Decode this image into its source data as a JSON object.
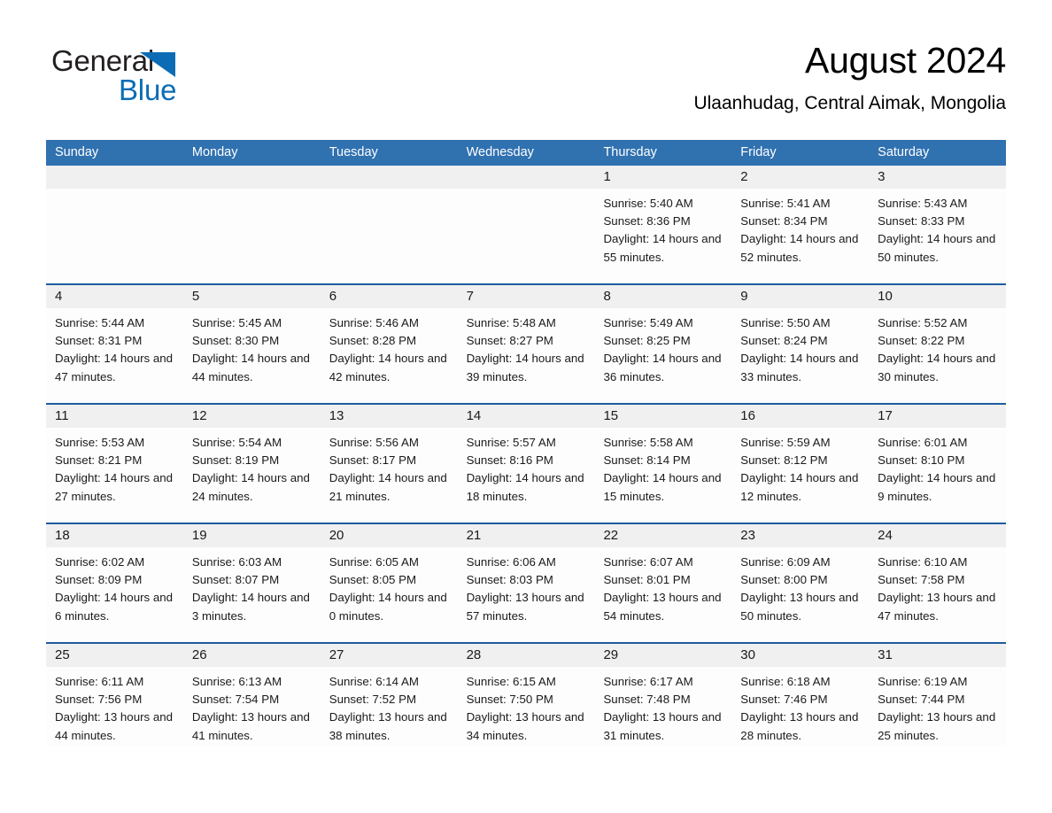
{
  "logo": {
    "word_general": "General",
    "word_blue": "Blue",
    "triangle_color": "#0b6cb5"
  },
  "header": {
    "title": "August 2024",
    "location": "Ulaanhudag, Central Aimak, Mongolia"
  },
  "theme": {
    "header_blue": "#3071b0",
    "separator_blue": "#1f5c9e",
    "daynum_band": "#f0f0f0",
    "text": "#1a1a1a"
  },
  "day_headers": [
    "Sunday",
    "Monday",
    "Tuesday",
    "Wednesday",
    "Thursday",
    "Friday",
    "Saturday"
  ],
  "weeks": [
    [
      {
        "day": "",
        "sunrise": "",
        "sunset": "",
        "daylight": ""
      },
      {
        "day": "",
        "sunrise": "",
        "sunset": "",
        "daylight": ""
      },
      {
        "day": "",
        "sunrise": "",
        "sunset": "",
        "daylight": ""
      },
      {
        "day": "",
        "sunrise": "",
        "sunset": "",
        "daylight": ""
      },
      {
        "day": "1",
        "sunrise": "Sunrise: 5:40 AM",
        "sunset": "Sunset: 8:36 PM",
        "daylight": "Daylight: 14 hours and 55 minutes."
      },
      {
        "day": "2",
        "sunrise": "Sunrise: 5:41 AM",
        "sunset": "Sunset: 8:34 PM",
        "daylight": "Daylight: 14 hours and 52 minutes."
      },
      {
        "day": "3",
        "sunrise": "Sunrise: 5:43 AM",
        "sunset": "Sunset: 8:33 PM",
        "daylight": "Daylight: 14 hours and 50 minutes."
      }
    ],
    [
      {
        "day": "4",
        "sunrise": "Sunrise: 5:44 AM",
        "sunset": "Sunset: 8:31 PM",
        "daylight": "Daylight: 14 hours and 47 minutes."
      },
      {
        "day": "5",
        "sunrise": "Sunrise: 5:45 AM",
        "sunset": "Sunset: 8:30 PM",
        "daylight": "Daylight: 14 hours and 44 minutes."
      },
      {
        "day": "6",
        "sunrise": "Sunrise: 5:46 AM",
        "sunset": "Sunset: 8:28 PM",
        "daylight": "Daylight: 14 hours and 42 minutes."
      },
      {
        "day": "7",
        "sunrise": "Sunrise: 5:48 AM",
        "sunset": "Sunset: 8:27 PM",
        "daylight": "Daylight: 14 hours and 39 minutes."
      },
      {
        "day": "8",
        "sunrise": "Sunrise: 5:49 AM",
        "sunset": "Sunset: 8:25 PM",
        "daylight": "Daylight: 14 hours and 36 minutes."
      },
      {
        "day": "9",
        "sunrise": "Sunrise: 5:50 AM",
        "sunset": "Sunset: 8:24 PM",
        "daylight": "Daylight: 14 hours and 33 minutes."
      },
      {
        "day": "10",
        "sunrise": "Sunrise: 5:52 AM",
        "sunset": "Sunset: 8:22 PM",
        "daylight": "Daylight: 14 hours and 30 minutes."
      }
    ],
    [
      {
        "day": "11",
        "sunrise": "Sunrise: 5:53 AM",
        "sunset": "Sunset: 8:21 PM",
        "daylight": "Daylight: 14 hours and 27 minutes."
      },
      {
        "day": "12",
        "sunrise": "Sunrise: 5:54 AM",
        "sunset": "Sunset: 8:19 PM",
        "daylight": "Daylight: 14 hours and 24 minutes."
      },
      {
        "day": "13",
        "sunrise": "Sunrise: 5:56 AM",
        "sunset": "Sunset: 8:17 PM",
        "daylight": "Daylight: 14 hours and 21 minutes."
      },
      {
        "day": "14",
        "sunrise": "Sunrise: 5:57 AM",
        "sunset": "Sunset: 8:16 PM",
        "daylight": "Daylight: 14 hours and 18 minutes."
      },
      {
        "day": "15",
        "sunrise": "Sunrise: 5:58 AM",
        "sunset": "Sunset: 8:14 PM",
        "daylight": "Daylight: 14 hours and 15 minutes."
      },
      {
        "day": "16",
        "sunrise": "Sunrise: 5:59 AM",
        "sunset": "Sunset: 8:12 PM",
        "daylight": "Daylight: 14 hours and 12 minutes."
      },
      {
        "day": "17",
        "sunrise": "Sunrise: 6:01 AM",
        "sunset": "Sunset: 8:10 PM",
        "daylight": "Daylight: 14 hours and 9 minutes."
      }
    ],
    [
      {
        "day": "18",
        "sunrise": "Sunrise: 6:02 AM",
        "sunset": "Sunset: 8:09 PM",
        "daylight": "Daylight: 14 hours and 6 minutes."
      },
      {
        "day": "19",
        "sunrise": "Sunrise: 6:03 AM",
        "sunset": "Sunset: 8:07 PM",
        "daylight": "Daylight: 14 hours and 3 minutes."
      },
      {
        "day": "20",
        "sunrise": "Sunrise: 6:05 AM",
        "sunset": "Sunset: 8:05 PM",
        "daylight": "Daylight: 14 hours and 0 minutes."
      },
      {
        "day": "21",
        "sunrise": "Sunrise: 6:06 AM",
        "sunset": "Sunset: 8:03 PM",
        "daylight": "Daylight: 13 hours and 57 minutes."
      },
      {
        "day": "22",
        "sunrise": "Sunrise: 6:07 AM",
        "sunset": "Sunset: 8:01 PM",
        "daylight": "Daylight: 13 hours and 54 minutes."
      },
      {
        "day": "23",
        "sunrise": "Sunrise: 6:09 AM",
        "sunset": "Sunset: 8:00 PM",
        "daylight": "Daylight: 13 hours and 50 minutes."
      },
      {
        "day": "24",
        "sunrise": "Sunrise: 6:10 AM",
        "sunset": "Sunset: 7:58 PM",
        "daylight": "Daylight: 13 hours and 47 minutes."
      }
    ],
    [
      {
        "day": "25",
        "sunrise": "Sunrise: 6:11 AM",
        "sunset": "Sunset: 7:56 PM",
        "daylight": "Daylight: 13 hours and 44 minutes."
      },
      {
        "day": "26",
        "sunrise": "Sunrise: 6:13 AM",
        "sunset": "Sunset: 7:54 PM",
        "daylight": "Daylight: 13 hours and 41 minutes."
      },
      {
        "day": "27",
        "sunrise": "Sunrise: 6:14 AM",
        "sunset": "Sunset: 7:52 PM",
        "daylight": "Daylight: 13 hours and 38 minutes."
      },
      {
        "day": "28",
        "sunrise": "Sunrise: 6:15 AM",
        "sunset": "Sunset: 7:50 PM",
        "daylight": "Daylight: 13 hours and 34 minutes."
      },
      {
        "day": "29",
        "sunrise": "Sunrise: 6:17 AM",
        "sunset": "Sunset: 7:48 PM",
        "daylight": "Daylight: 13 hours and 31 minutes."
      },
      {
        "day": "30",
        "sunrise": "Sunrise: 6:18 AM",
        "sunset": "Sunset: 7:46 PM",
        "daylight": "Daylight: 13 hours and 28 minutes."
      },
      {
        "day": "31",
        "sunrise": "Sunrise: 6:19 AM",
        "sunset": "Sunset: 7:44 PM",
        "daylight": "Daylight: 13 hours and 25 minutes."
      }
    ]
  ]
}
